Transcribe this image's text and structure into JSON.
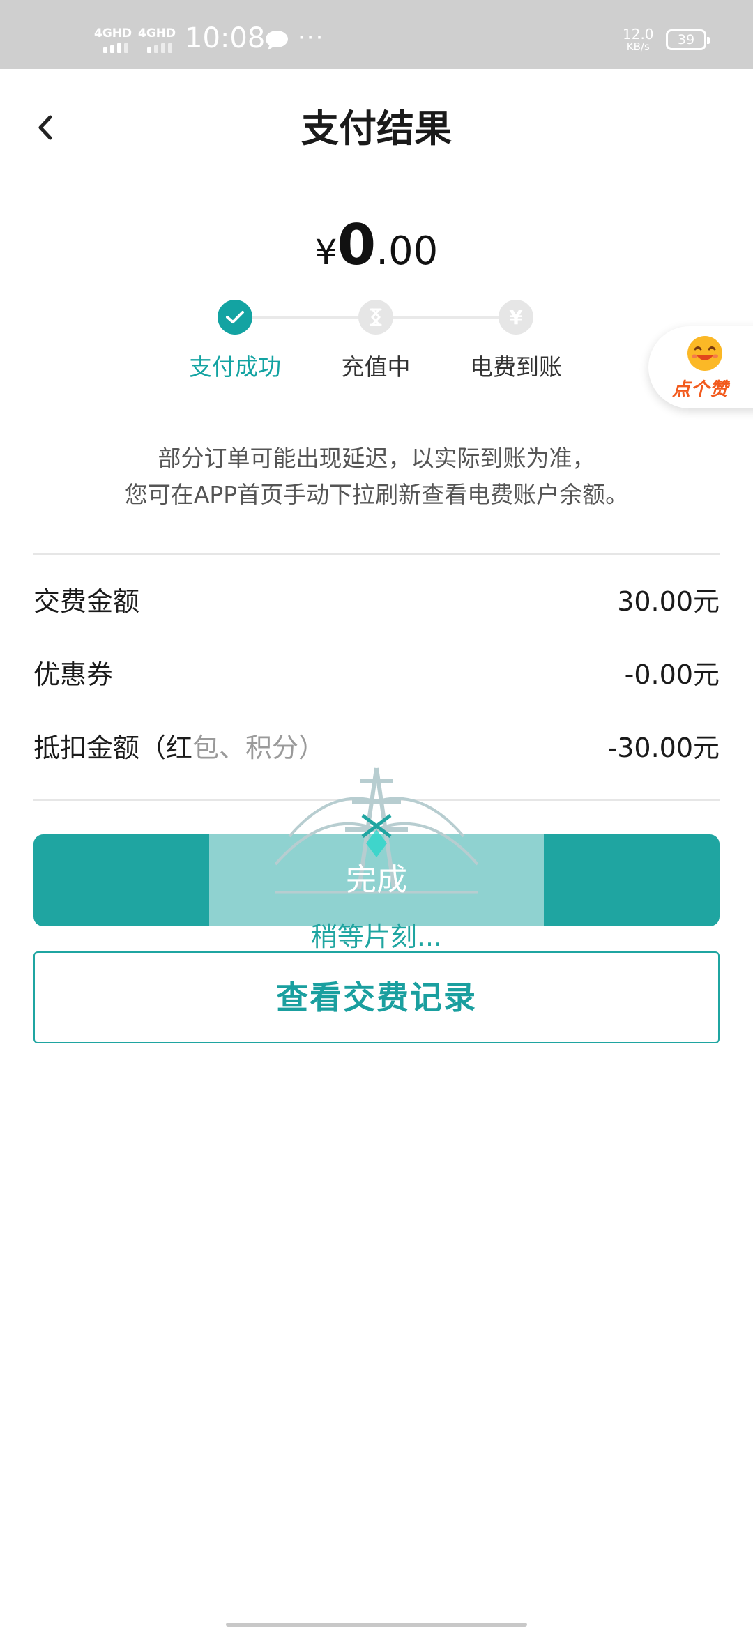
{
  "status_bar": {
    "network1": "4GHD",
    "network2": "4GHD",
    "time": "10:08",
    "speed_value": "12.0",
    "speed_unit": "KB/s",
    "battery": "39"
  },
  "header": {
    "title": "支付结果",
    "back_icon": "chevron-left-icon"
  },
  "amount": {
    "currency": "¥",
    "integer": "0",
    "decimal": ".00"
  },
  "steps": [
    {
      "label": "支付成功",
      "state": "done",
      "icon": "check-icon"
    },
    {
      "label": "充值中",
      "state": "pending",
      "icon": "hourglass-icon"
    },
    {
      "label": "电费到账",
      "state": "pending",
      "icon": "yen-icon"
    }
  ],
  "like_badge": {
    "label": "点个赞",
    "icon": "smile-face-icon"
  },
  "notice": {
    "line1": "部分订单可能出现延迟，以实际到账为准，",
    "line2": "您可在APP首页手动下拉刷新查看电费账户余额。"
  },
  "details": [
    {
      "label": "交费金额",
      "value": "30.00元"
    },
    {
      "label": "优惠券",
      "value": "-0.00元"
    },
    {
      "label_main": "抵扣金额（红",
      "label_faded": "包、积分）",
      "value": "-30.00元"
    }
  ],
  "buttons": {
    "done": "完成",
    "view_records": "查看交费记录"
  },
  "loading": {
    "text": "稍等片刻...",
    "icon": "power-tower-icon"
  },
  "colors": {
    "accent": "#1fa5a1",
    "statusbar": "#cfcfcf",
    "like_text": "#f25a1d"
  }
}
